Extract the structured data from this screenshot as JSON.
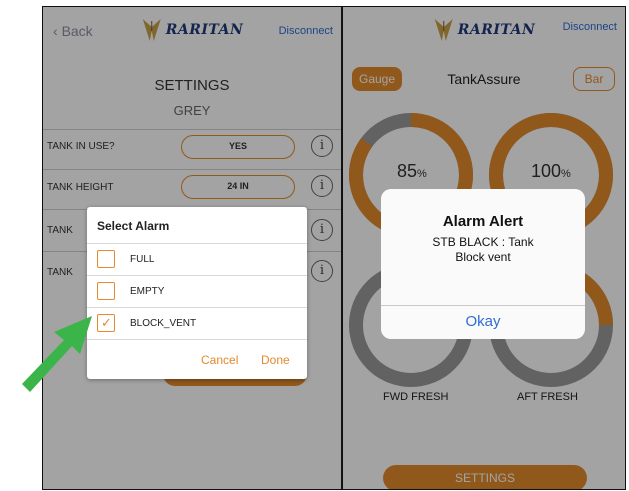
{
  "left_screen": {
    "header": {
      "back_label": "Back",
      "logo_text": "RARITAN",
      "disconnect_label": "Disconnect"
    },
    "title": "SETTINGS",
    "tank_color": "GREY",
    "rows": [
      {
        "label": "TANK IN USE?",
        "value": "YES"
      },
      {
        "label": "TANK HEIGHT",
        "value": "24 IN"
      },
      {
        "label": "TANK",
        "value": ""
      },
      {
        "label": "TANK",
        "value": ""
      }
    ],
    "info_glyph": "i"
  },
  "select_alarm_dialog": {
    "title": "Select Alarm",
    "options": [
      {
        "label": "FULL",
        "checked": false
      },
      {
        "label": "EMPTY",
        "checked": false
      },
      {
        "label": "BLOCK_VENT",
        "checked": true
      }
    ],
    "check_glyph": "✓",
    "cancel_label": "Cancel",
    "done_label": "Done"
  },
  "right_screen": {
    "header": {
      "logo_text": "RARITAN",
      "disconnect_label": "Disconnect"
    },
    "gauge_button": "Gauge",
    "bar_button": "Bar",
    "title": "TankAssure",
    "tanks": [
      {
        "percent": "85",
        "unit": "%",
        "level": 0.85
      },
      {
        "percent": "100",
        "unit": "%",
        "level": 1.0
      },
      {
        "name": "FWD FRESH"
      },
      {
        "name": "AFT FRESH"
      }
    ],
    "settings_button": "SETTINGS"
  },
  "alert": {
    "title": "Alarm Alert",
    "message_line1": "STB BLACK : Tank",
    "message_line2": "Block vent",
    "ok_label": "Okay"
  },
  "colors": {
    "accent": "#e38a2c",
    "link": "#2f6bd6",
    "arrow": "#3bb44a",
    "gauge_track": "#9a9a9a"
  },
  "icons": {
    "arrow": "green-arrow-icon",
    "info": "info-icon",
    "logo": "raritan-logo-icon",
    "back": "chevron-left-icon"
  }
}
